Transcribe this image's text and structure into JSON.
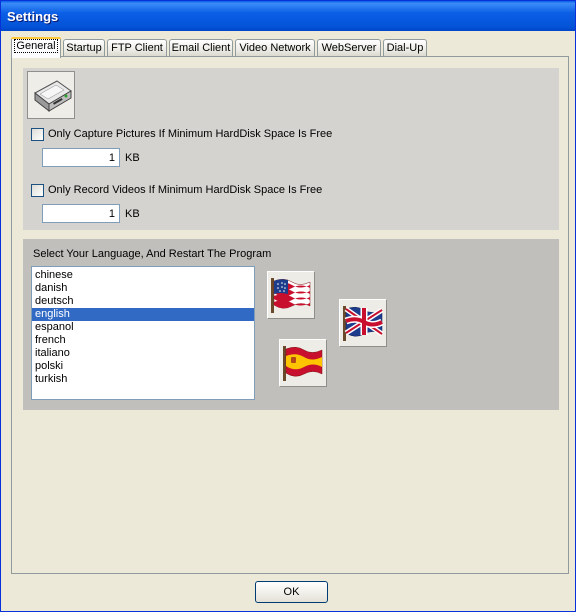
{
  "window": {
    "title": "Settings"
  },
  "tabs": [
    {
      "label": "General",
      "active": true
    },
    {
      "label": "Startup",
      "active": false
    },
    {
      "label": "FTP Client",
      "active": false
    },
    {
      "label": "Email Client",
      "active": false
    },
    {
      "label": "Video Network",
      "active": false
    },
    {
      "label": "WebServer",
      "active": false
    },
    {
      "label": "Dial-Up",
      "active": false
    }
  ],
  "disk": {
    "icon": "hard-disk-icon",
    "pictures": {
      "label": "Only Capture Pictures If Minimum HardDisk Space Is Free",
      "checked": false,
      "value": "1",
      "unit": "KB"
    },
    "videos": {
      "label": "Only Record Videos If Minimum HardDisk Space Is Free",
      "checked": false,
      "value": "1",
      "unit": "KB"
    }
  },
  "language": {
    "caption": "Select Your Language, And Restart The Program",
    "options": [
      "chinese",
      "danish",
      "deutsch",
      "english",
      "espanol",
      "french",
      "italiano",
      "polski",
      "turkish"
    ],
    "selected": "english",
    "flags": [
      "us-flag-icon",
      "uk-flag-icon",
      "spain-flag-icon"
    ]
  },
  "footer": {
    "ok_label": "OK"
  },
  "colors": {
    "title_bar": "#0453D8",
    "selection": "#316AC5",
    "group1_bg": "#D4D3CF",
    "group2_bg": "#C0BFBB"
  }
}
